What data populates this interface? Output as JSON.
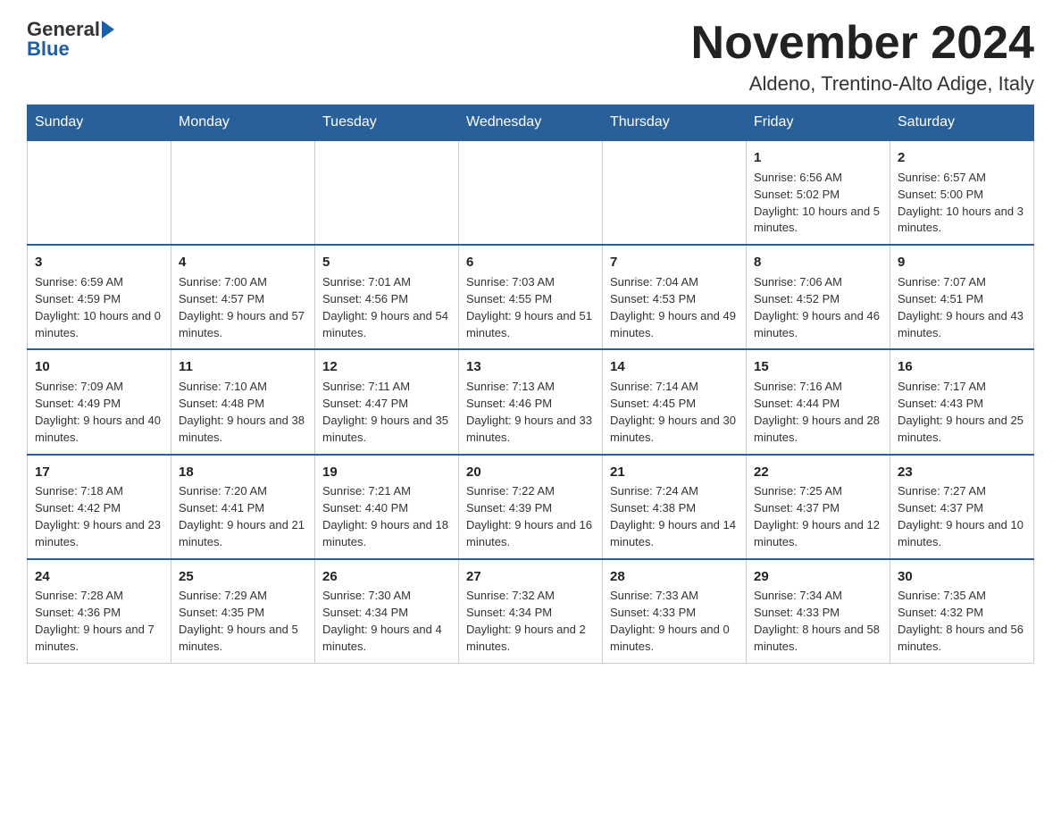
{
  "header": {
    "logo_general": "General",
    "logo_blue": "Blue",
    "month_title": "November 2024",
    "location": "Aldeno, Trentino-Alto Adige, Italy"
  },
  "weekdays": [
    "Sunday",
    "Monday",
    "Tuesday",
    "Wednesday",
    "Thursday",
    "Friday",
    "Saturday"
  ],
  "weeks": [
    [
      {
        "day": "",
        "info": ""
      },
      {
        "day": "",
        "info": ""
      },
      {
        "day": "",
        "info": ""
      },
      {
        "day": "",
        "info": ""
      },
      {
        "day": "",
        "info": ""
      },
      {
        "day": "1",
        "info": "Sunrise: 6:56 AM\nSunset: 5:02 PM\nDaylight: 10 hours and 5 minutes."
      },
      {
        "day": "2",
        "info": "Sunrise: 6:57 AM\nSunset: 5:00 PM\nDaylight: 10 hours and 3 minutes."
      }
    ],
    [
      {
        "day": "3",
        "info": "Sunrise: 6:59 AM\nSunset: 4:59 PM\nDaylight: 10 hours and 0 minutes."
      },
      {
        "day": "4",
        "info": "Sunrise: 7:00 AM\nSunset: 4:57 PM\nDaylight: 9 hours and 57 minutes."
      },
      {
        "day": "5",
        "info": "Sunrise: 7:01 AM\nSunset: 4:56 PM\nDaylight: 9 hours and 54 minutes."
      },
      {
        "day": "6",
        "info": "Sunrise: 7:03 AM\nSunset: 4:55 PM\nDaylight: 9 hours and 51 minutes."
      },
      {
        "day": "7",
        "info": "Sunrise: 7:04 AM\nSunset: 4:53 PM\nDaylight: 9 hours and 49 minutes."
      },
      {
        "day": "8",
        "info": "Sunrise: 7:06 AM\nSunset: 4:52 PM\nDaylight: 9 hours and 46 minutes."
      },
      {
        "day": "9",
        "info": "Sunrise: 7:07 AM\nSunset: 4:51 PM\nDaylight: 9 hours and 43 minutes."
      }
    ],
    [
      {
        "day": "10",
        "info": "Sunrise: 7:09 AM\nSunset: 4:49 PM\nDaylight: 9 hours and 40 minutes."
      },
      {
        "day": "11",
        "info": "Sunrise: 7:10 AM\nSunset: 4:48 PM\nDaylight: 9 hours and 38 minutes."
      },
      {
        "day": "12",
        "info": "Sunrise: 7:11 AM\nSunset: 4:47 PM\nDaylight: 9 hours and 35 minutes."
      },
      {
        "day": "13",
        "info": "Sunrise: 7:13 AM\nSunset: 4:46 PM\nDaylight: 9 hours and 33 minutes."
      },
      {
        "day": "14",
        "info": "Sunrise: 7:14 AM\nSunset: 4:45 PM\nDaylight: 9 hours and 30 minutes."
      },
      {
        "day": "15",
        "info": "Sunrise: 7:16 AM\nSunset: 4:44 PM\nDaylight: 9 hours and 28 minutes."
      },
      {
        "day": "16",
        "info": "Sunrise: 7:17 AM\nSunset: 4:43 PM\nDaylight: 9 hours and 25 minutes."
      }
    ],
    [
      {
        "day": "17",
        "info": "Sunrise: 7:18 AM\nSunset: 4:42 PM\nDaylight: 9 hours and 23 minutes."
      },
      {
        "day": "18",
        "info": "Sunrise: 7:20 AM\nSunset: 4:41 PM\nDaylight: 9 hours and 21 minutes."
      },
      {
        "day": "19",
        "info": "Sunrise: 7:21 AM\nSunset: 4:40 PM\nDaylight: 9 hours and 18 minutes."
      },
      {
        "day": "20",
        "info": "Sunrise: 7:22 AM\nSunset: 4:39 PM\nDaylight: 9 hours and 16 minutes."
      },
      {
        "day": "21",
        "info": "Sunrise: 7:24 AM\nSunset: 4:38 PM\nDaylight: 9 hours and 14 minutes."
      },
      {
        "day": "22",
        "info": "Sunrise: 7:25 AM\nSunset: 4:37 PM\nDaylight: 9 hours and 12 minutes."
      },
      {
        "day": "23",
        "info": "Sunrise: 7:27 AM\nSunset: 4:37 PM\nDaylight: 9 hours and 10 minutes."
      }
    ],
    [
      {
        "day": "24",
        "info": "Sunrise: 7:28 AM\nSunset: 4:36 PM\nDaylight: 9 hours and 7 minutes."
      },
      {
        "day": "25",
        "info": "Sunrise: 7:29 AM\nSunset: 4:35 PM\nDaylight: 9 hours and 5 minutes."
      },
      {
        "day": "26",
        "info": "Sunrise: 7:30 AM\nSunset: 4:34 PM\nDaylight: 9 hours and 4 minutes."
      },
      {
        "day": "27",
        "info": "Sunrise: 7:32 AM\nSunset: 4:34 PM\nDaylight: 9 hours and 2 minutes."
      },
      {
        "day": "28",
        "info": "Sunrise: 7:33 AM\nSunset: 4:33 PM\nDaylight: 9 hours and 0 minutes."
      },
      {
        "day": "29",
        "info": "Sunrise: 7:34 AM\nSunset: 4:33 PM\nDaylight: 8 hours and 58 minutes."
      },
      {
        "day": "30",
        "info": "Sunrise: 7:35 AM\nSunset: 4:32 PM\nDaylight: 8 hours and 56 minutes."
      }
    ]
  ]
}
